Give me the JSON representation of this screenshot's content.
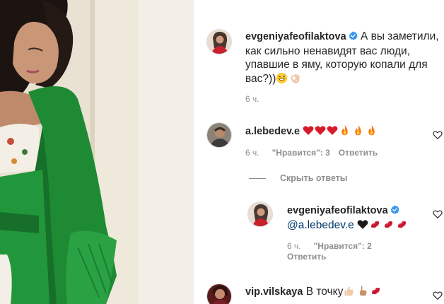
{
  "post_caption": {
    "username": "evgeniyafeofilaktova",
    "text": "А вы заметили, как сильно ненавидят вас люди, упавшие в яму, которую копали для вас?))",
    "time": "6 ч."
  },
  "comments": [
    {
      "username": "a.lebedev.e",
      "time": "6 ч.",
      "likes_label": "\"Нравится\": 3",
      "reply_label": "Ответить"
    },
    {
      "username": "vip.vilskaya",
      "text": "В точку"
    }
  ],
  "replies_toggle": {
    "label": "Скрыть ответы"
  },
  "reply": {
    "username": "evgeniyafeofilaktova",
    "mention": "@a.lebedev.e",
    "time": "6 ч.",
    "likes_label": "\"Нравится\": 2",
    "reply_label": "Ответить"
  },
  "icons": {
    "verified": "verified-badge-icon",
    "like": "heart-outline-icon"
  },
  "colors": {
    "verified_blue": "#3897f0",
    "mention_blue": "#00376b",
    "meta_gray": "#8e8e8e",
    "robe_green": "#1f8a34"
  }
}
